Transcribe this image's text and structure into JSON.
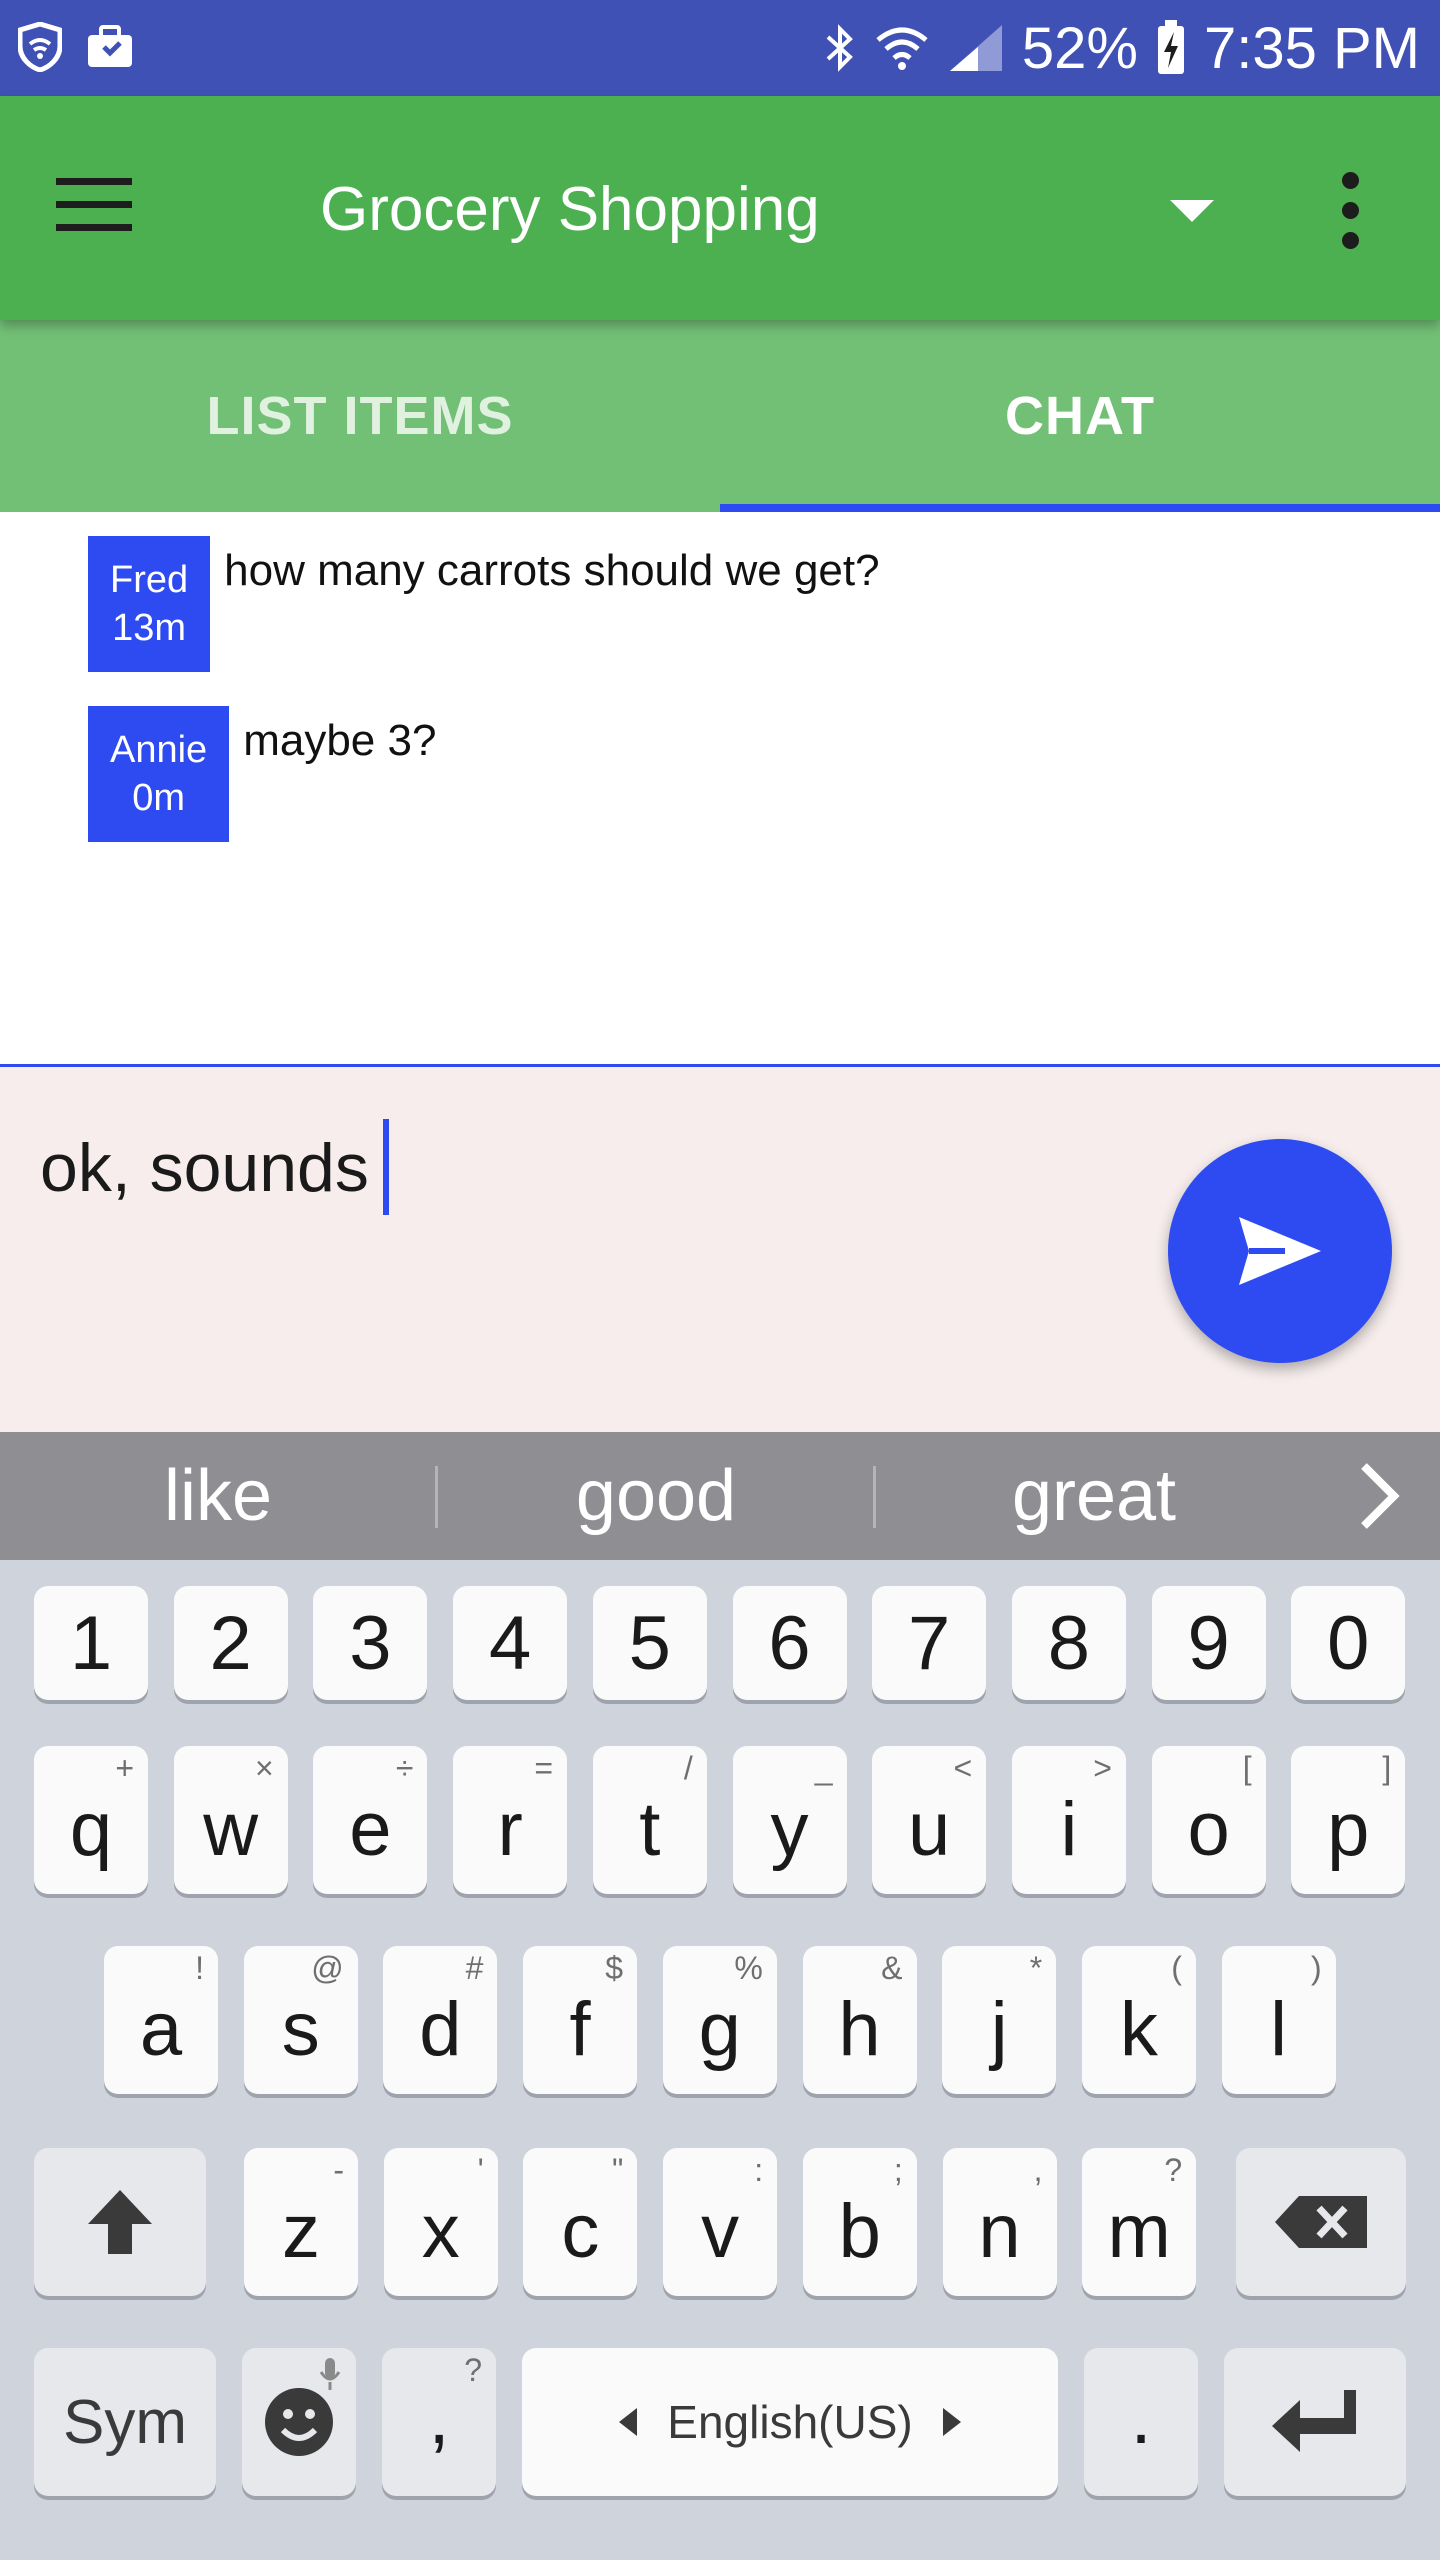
{
  "status_bar": {
    "battery": "52%",
    "time": "7:35 PM"
  },
  "app_bar": {
    "title": "Grocery Shopping"
  },
  "tabs": [
    {
      "label": "LIST ITEMS",
      "selected": false
    },
    {
      "label": "CHAT",
      "selected": true
    }
  ],
  "messages": [
    {
      "author": "Fred",
      "age": "13m",
      "text": "how many carrots should we get?"
    },
    {
      "author": "Annie",
      "age": "0m",
      "text": "maybe 3?"
    }
  ],
  "composer": {
    "value": "ok, sounds"
  },
  "suggestions": [
    "like",
    "good",
    "great"
  ],
  "keyboard": {
    "number_row": [
      "1",
      "2",
      "3",
      "4",
      "5",
      "6",
      "7",
      "8",
      "9",
      "0"
    ],
    "row1": {
      "keys": [
        "q",
        "w",
        "e",
        "r",
        "t",
        "y",
        "u",
        "i",
        "o",
        "p"
      ],
      "alts": [
        "+",
        "×",
        "÷",
        "=",
        "/",
        "_",
        "<",
        ">",
        "[",
        "]"
      ]
    },
    "row2": {
      "keys": [
        "a",
        "s",
        "d",
        "f",
        "g",
        "h",
        "j",
        "k",
        "l"
      ],
      "alts": [
        "!",
        "@",
        "#",
        "$",
        "%",
        "&",
        "*",
        "(",
        ")"
      ]
    },
    "row3": {
      "keys": [
        "z",
        "x",
        "c",
        "v",
        "b",
        "n",
        "m"
      ],
      "alts": [
        "-",
        "'",
        "\"",
        ":",
        ";",
        ",",
        "?"
      ]
    },
    "sym_label": "Sym",
    "comma": ",",
    "comma_alt": "?",
    "space_label": "English(US)",
    "period": "."
  },
  "colors": {
    "status_bar": "#3f51b5",
    "app_bar": "#4caf50",
    "tabs": "#72bf76",
    "accent": "#2d4bf0",
    "composer_bg": "#f7eded",
    "keyboard_bg": "#cfd3dc"
  },
  "icons": {
    "status_left": [
      "shield-wifi-icon",
      "briefcase-icon"
    ],
    "status_right": [
      "bluetooth-icon",
      "wifi-icon",
      "signal-icon",
      "battery-charging-icon"
    ],
    "send": "send-icon",
    "menu": "hamburger-menu-icon",
    "more": "overflow-menu-icon"
  }
}
